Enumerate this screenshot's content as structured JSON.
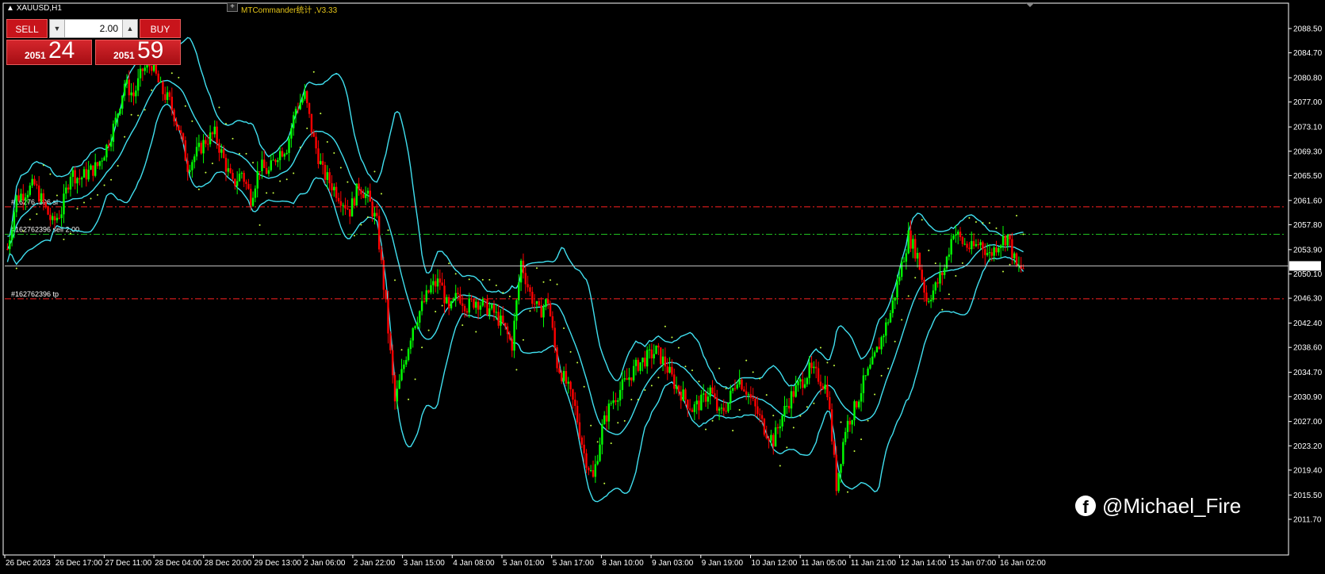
{
  "symbol_title": "XAUUSD,H1",
  "indicator_title": "MTCommander统计 ,V3.33",
  "trade_panel": {
    "sell_label": "SELL",
    "buy_label": "BUY",
    "lot_value": "2.00",
    "bid_small": "2051",
    "bid_big": "24",
    "ask_small": "2051",
    "ask_big": "59"
  },
  "current_price_label": "2051.35",
  "order_lines": {
    "sl_label": "#16276 .396 sl",
    "open_label": "#162762396 sell 2.00",
    "tp_label": "#162762396 tp"
  },
  "watermark": {
    "text": "@Michael_Fire",
    "icon": "facebook-icon"
  },
  "colors": {
    "background": "#000000",
    "bull_candle": "#00ff00",
    "bear_candle": "#ff0000",
    "bollinger": "#40e0f0",
    "sar": "#c8ff40",
    "sl_tp_line": "#ff2020",
    "open_line": "#20c020",
    "buttons": "#c8141b"
  },
  "chart_data": {
    "type": "candlestick",
    "symbol": "XAUUSD",
    "timeframe": "H1",
    "price_axis_ticks": [
      "2088.50",
      "2084.70",
      "2080.80",
      "2077.00",
      "2073.10",
      "2069.30",
      "2065.50",
      "2061.60",
      "2057.80",
      "2053.90",
      "2050.10",
      "2046.30",
      "2042.40",
      "2038.60",
      "2034.70",
      "2030.90",
      "2027.00",
      "2023.20",
      "2019.40",
      "2015.50",
      "2011.70"
    ],
    "time_axis_ticks": [
      "26 Dec 2023",
      "26 Dec 17:00",
      "27 Dec 11:00",
      "28 Dec 04:00",
      "28 Dec 20:00",
      "29 Dec 13:00",
      "2 Jan 06:00",
      "2 Jan 22:00",
      "3 Jan 15:00",
      "4 Jan 08:00",
      "5 Jan 01:00",
      "5 Jan 17:00",
      "8 Jan 10:00",
      "9 Jan 03:00",
      "9 Jan 19:00",
      "10 Jan 12:00",
      "11 Jan 05:00",
      "11 Jan 21:00",
      "12 Jan 14:00",
      "15 Jan 07:00",
      "16 Jan 02:00"
    ],
    "ylim": [
      2011.7,
      2088.5
    ],
    "current_price": 2051.35,
    "order_levels": {
      "sl": 2060.6,
      "open": 2056.3,
      "tp": 2046.2
    },
    "close_path": [
      2054,
      2062,
      2063,
      2064,
      2061,
      2058,
      2060,
      2066,
      2065,
      2066,
      2067,
      2070,
      2074,
      2080,
      2078,
      2082,
      2083,
      2079,
      2077,
      2073,
      2067,
      2069,
      2071,
      2072,
      2068,
      2064,
      2066,
      2062,
      2067,
      2066,
      2069,
      2070,
      2076,
      2078,
      2071,
      2066,
      2064,
      2062,
      2060,
      2064,
      2062,
      2058,
      2045,
      2030,
      2036,
      2042,
      2045,
      2048,
      2049,
      2044,
      2047,
      2045,
      2046,
      2045,
      2044,
      2042,
      2039,
      2052,
      2047,
      2044,
      2046,
      2036,
      2033,
      2029,
      2022,
      2018,
      2026,
      2030,
      2032,
      2034,
      2036,
      2037,
      2038,
      2036,
      2033,
      2031,
      2029,
      2030,
      2032,
      2028,
      2030,
      2034,
      2032,
      2029,
      2026,
      2024,
      2028,
      2031,
      2033,
      2035,
      2034,
      2032,
      2017,
      2026,
      2029,
      2033,
      2036,
      2040,
      2044,
      2050,
      2056,
      2053,
      2046,
      2048,
      2051,
      2057,
      2055,
      2054,
      2055,
      2053,
      2055,
      2056,
      2051
    ],
    "indicators": [
      "Bollinger Bands",
      "Parabolic SAR"
    ]
  }
}
